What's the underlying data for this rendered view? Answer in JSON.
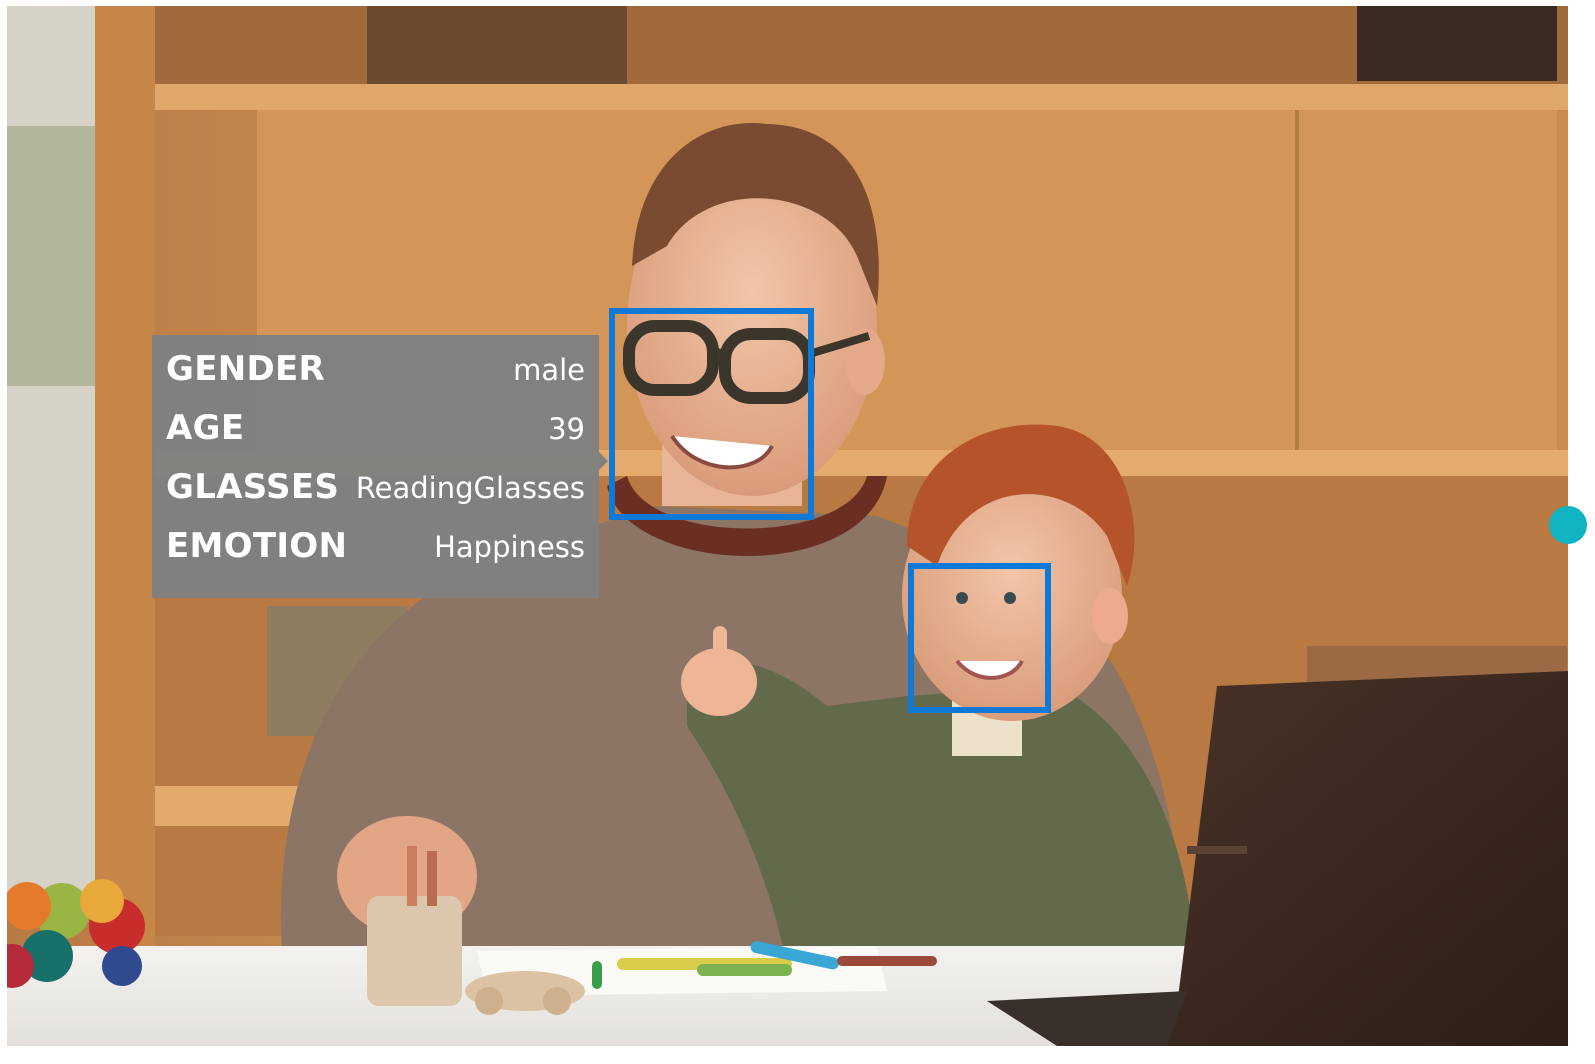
{
  "accent_color": "#0f79d8",
  "dot_color": "#0fb3c2",
  "faces": [
    {
      "attributes": [
        {
          "key": "GENDER",
          "value": "male"
        },
        {
          "key": "AGE",
          "value": "39"
        },
        {
          "key": "GLASSES",
          "value": "ReadingGlasses"
        },
        {
          "key": "EMOTION",
          "value": "Happiness"
        }
      ]
    },
    {
      "attributes": []
    }
  ]
}
